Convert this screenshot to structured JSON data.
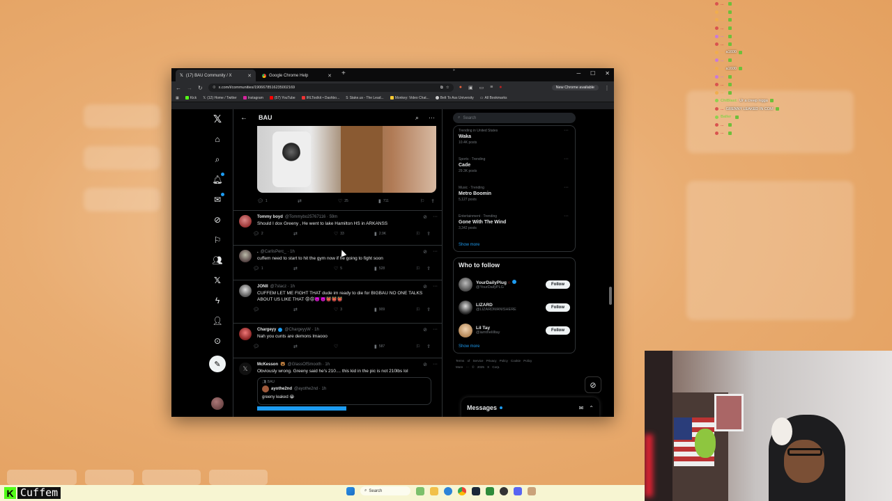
{
  "browser": {
    "tabs": [
      {
        "label": "(17) BAU Community / X",
        "active": true
      },
      {
        "label": "Google Chrome Help",
        "active": false
      }
    ],
    "url": "x.com/i/communities/1906678516235002169",
    "update_label": "New Chrome available",
    "bookmarks": [
      "Kick",
      "(12) Home / Twitter",
      "Instagram",
      "(57) YouTube",
      "IRLToolkit • Dashbo...",
      "Stake.us - The Lead...",
      "Monkey: Video Chat...",
      "Belt To Ass University"
    ],
    "all_bookmarks": "All Bookmarks"
  },
  "community": {
    "title": "BAU"
  },
  "first_post_stats": {
    "replies": "1",
    "likes": "25",
    "views": "711"
  },
  "tweets": [
    {
      "name": "Tommy boyd",
      "handle": "@Tommybo25767116 · 59m",
      "text": "Should I dox Greeny , He went to lake Hamilton  HS in ARKANSS",
      "replies": "2",
      "reposts": "",
      "likes": "33",
      "views": "2.9K"
    },
    {
      "name": ".",
      "handle": "@CarlisPerc_ · 1h",
      "text": "cuffem need to start to hit the gym now if he going to fight soon",
      "replies": "1",
      "reposts": "",
      "likes": "5",
      "views": "528"
    },
    {
      "name": "JONII",
      "handle": "@7stacz · 1h",
      "text": "CUFFEM LET ME FIGHT THAT dude im ready to die for BIGBAU NO ONE TALKS ABOUT US LIKE THAT 😡😡👿👿👹👹👹",
      "replies": "",
      "reposts": "",
      "likes": "3",
      "views": "909"
    },
    {
      "name": "Chargeyy",
      "handle": "@ChargeyyW · 1h",
      "text": "Nah you cunts are demons lmaooo",
      "replies": "",
      "reposts": "",
      "likes": "",
      "views": "587"
    },
    {
      "name": "McKesson",
      "handle": "@GlassOfSmooth · 1h",
      "text": "Obviously wrong. Greeny said he's 210.... this kid in the pic is not 210lbs lol",
      "quote": {
        "badge": "BAU",
        "name": "ayothe2nd",
        "handle": "@ayothe2nd · 1h",
        "text": "greeny leaked 😭"
      }
    }
  ],
  "search": {
    "placeholder": "Search"
  },
  "trends": [
    {
      "category": "Trending in United States",
      "name": "Waka",
      "count": "10.4K posts"
    },
    {
      "category": "Sports · Trending",
      "name": "Cade",
      "count": "29.3K posts"
    },
    {
      "category": "Music · Trending",
      "name": "Metro Boomin",
      "count": "5,127 posts"
    },
    {
      "category": "Entertainment · Trending",
      "name": "Gone With The Wind",
      "count": "3,342 posts"
    }
  ],
  "show_more": "Show more",
  "who_to_follow": {
    "title": "Who to follow",
    "users": [
      {
        "name": "YourDailyPlug",
        "handle": "@YourDailyPLG"
      },
      {
        "name": "LIZARD",
        "handle": "@LIZARDMANISHERE"
      },
      {
        "name": "Lil Tay",
        "handle": "@iamthelilltay"
      }
    ],
    "follow_label": "Follow",
    "show_more": "Show more"
  },
  "footer": {
    "links": "Terms of Service   Privacy Policy   Cookie Policy",
    "more": "More ···   © 2025 X Corp."
  },
  "messages": {
    "label": "Messages"
  },
  "chat": [
    {
      "user": "...",
      "msg": "",
      "color": "#d9534f"
    },
    {
      "user": "...",
      "msg": "",
      "color": "#f0ad4e"
    },
    {
      "user": "...",
      "msg": "",
      "color": "#f0ad4e"
    },
    {
      "user": "...",
      "msg": "",
      "color": "#d9534f"
    },
    {
      "user": "...",
      "msg": "",
      "color": "#c97ad8"
    },
    {
      "user": "...",
      "msg": "",
      "color": "#d9534f"
    },
    {
      "user": "...",
      "msg": "a1600",
      "color": "#f0ad4e"
    },
    {
      "user": "...",
      "msg": "",
      "color": "#c97ad8"
    },
    {
      "user": "...",
      "msg": "a1600",
      "color": "#f0ad4e"
    },
    {
      "user": "...",
      "msg": "",
      "color": "#c97ad8"
    },
    {
      "user": "...",
      "msg": "",
      "color": "#d9534f"
    },
    {
      "user": "...",
      "msg": "",
      "color": "#f0ad4e"
    },
    {
      "user": "ChiBlast:",
      "msg": "Ur a creep nigga",
      "color": "#8fd14f"
    },
    {
      "user": "...",
      "msg": "GRENNY LEAKED IN COM",
      "color": "#d9534f"
    },
    {
      "user": "Baller",
      "msg": "",
      "color": "#8fd14f"
    },
    {
      "user": "...",
      "msg": "",
      "color": "#d9534f"
    },
    {
      "user": "...",
      "msg": "",
      "color": "#d9534f"
    }
  ],
  "stream": {
    "brand_letter": "K",
    "streamer": "Cuffem"
  },
  "taskbar": {
    "search": "Search"
  }
}
